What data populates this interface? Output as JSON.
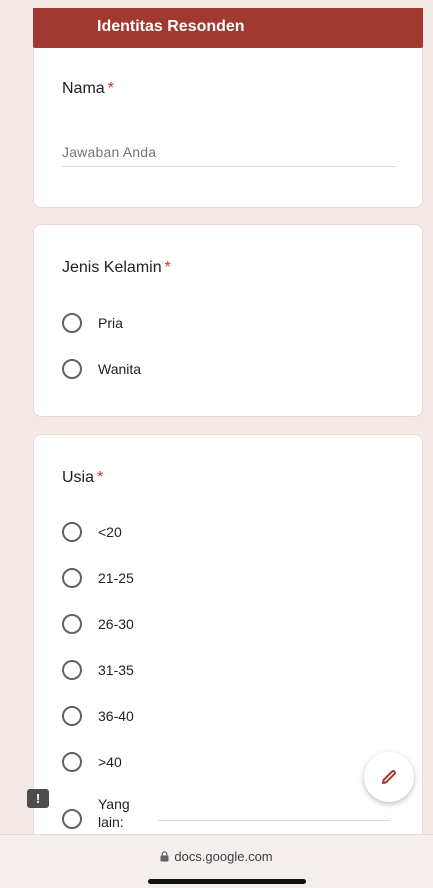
{
  "header": {
    "title": "Identitas Resonden"
  },
  "q_nama": {
    "title": "Nama",
    "required": "*",
    "placeholder": "Jawaban Anda"
  },
  "q_jk": {
    "title": "Jenis Kelamin",
    "required": "*",
    "options": [
      "Pria",
      "Wanita"
    ]
  },
  "q_usia": {
    "title": "Usia",
    "required": "*",
    "options": [
      "<20",
      "21-25",
      "26-30",
      "31-35",
      "36-40",
      ">40"
    ],
    "other_label": "Yang lain:"
  },
  "fab": {
    "icon": "pencil-icon"
  },
  "feedback": {
    "icon": "feedback-icon",
    "glyph": "!"
  },
  "browser": {
    "url": "docs.google.com"
  },
  "colors": {
    "accent": "#a0392f",
    "background": "#f3e9e7",
    "required": "#d93025"
  }
}
